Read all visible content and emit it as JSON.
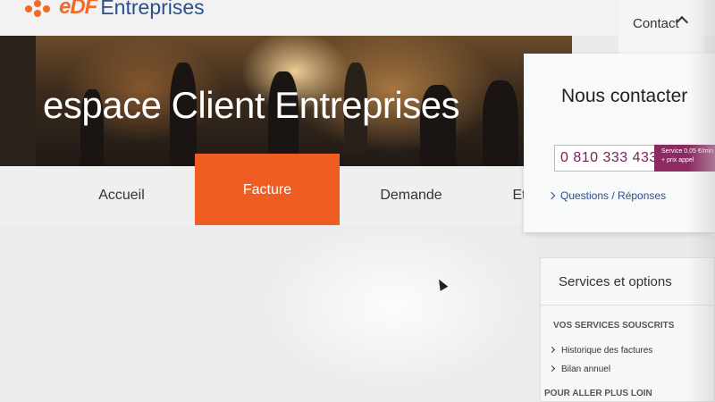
{
  "header": {
    "logo_edf": "eDF",
    "logo_entreprises": "Entreprises",
    "contact_label": "Contact"
  },
  "hero": {
    "title": "espace Client Entreprises"
  },
  "nav": {
    "tabs": [
      {
        "label": "Accueil"
      },
      {
        "label": "Facture",
        "active": true
      },
      {
        "label": "Demande"
      },
      {
        "label": "Et"
      }
    ]
  },
  "contact_panel": {
    "title": "Nous contacter",
    "phone": "0 810 333 433",
    "phone_note": "Service 0,05 €/min + prix appel",
    "faq_link": "Questions / Réponses"
  },
  "services": {
    "title": "Services et options",
    "section1": "VOS SERVICES SOUSCRITS",
    "links": [
      {
        "label": "Historique des factures"
      },
      {
        "label": "Bilan annuel"
      }
    ],
    "section2": "POUR ALLER PLUS LOIN"
  },
  "colors": {
    "brand_orange": "#f05d23",
    "brand_blue": "#2e4f8c",
    "phone_purple": "#8c2a61"
  }
}
